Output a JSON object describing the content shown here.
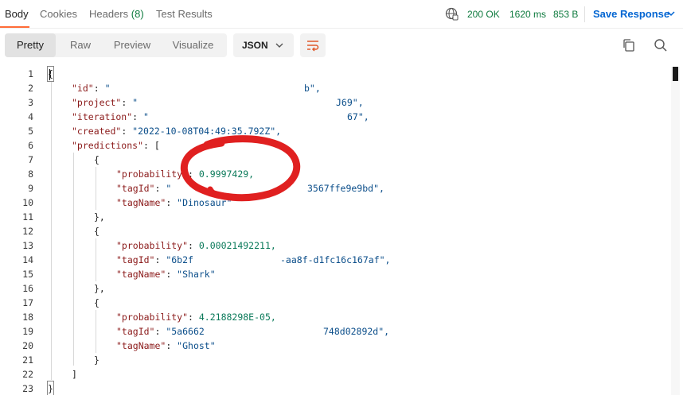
{
  "tabs": {
    "items": [
      {
        "label": "Body",
        "active": true
      },
      {
        "label": "Cookies"
      },
      {
        "label": "Headers",
        "count": "(8)"
      },
      {
        "label": "Test Results"
      }
    ]
  },
  "status": {
    "code": "200 OK",
    "time": "1620 ms",
    "size": "853 B",
    "save_label": "Save Response",
    "ok_color": "#0f7b3f",
    "accent": "#ff6c37"
  },
  "toolbar": {
    "views": [
      "Pretty",
      "Raw",
      "Preview",
      "Visualize"
    ],
    "active_view": "Pretty",
    "format": "JSON",
    "icons": [
      "wrap-lines-icon",
      "copy-icon",
      "search-icon"
    ]
  },
  "editor": {
    "line_numbers": [
      "1",
      "2",
      "3",
      "4",
      "5",
      "6",
      "7",
      "8",
      "9",
      "10",
      "11",
      "12",
      "13",
      "14",
      "15",
      "16",
      "17",
      "18",
      "19",
      "20",
      "21",
      "22",
      "23"
    ],
    "lines": [
      {
        "open": "{"
      },
      {
        "key": "\"id\"",
        "colon": ": ",
        "value": "\"",
        "tail": "b\","
      },
      {
        "key": "\"project\"",
        "colon": ": ",
        "value": "\"",
        "tail": "J69\","
      },
      {
        "key": "\"iteration\"",
        "colon": ": ",
        "value": "\"",
        "tail": "67\","
      },
      {
        "key": "\"created\"",
        "colon": ": ",
        "value": "\"2022-10-08T04:49:35.792Z\","
      },
      {
        "key": "\"predictions\"",
        "colon": ": ",
        "value": "["
      },
      {
        "open": "{"
      },
      {
        "key": "\"probability\"",
        "colon": ": ",
        "num": "0.9997429,"
      },
      {
        "key": "\"tagId\"",
        "colon": ": ",
        "value": "\"",
        "tail": "3567ffe9e9bd\","
      },
      {
        "key": "\"tagName\"",
        "colon": ": ",
        "value": "\"Dinosaur\""
      },
      {
        "open": "},"
      },
      {
        "open": "{"
      },
      {
        "key": "\"probability\"",
        "colon": ": ",
        "num": "0.00021492211,"
      },
      {
        "key": "\"tagId\"",
        "colon": ": ",
        "value": "\"6b2f",
        "tail": "-aa8f-d1fc16c167af\","
      },
      {
        "key": "\"tagName\"",
        "colon": ": ",
        "value": "\"Shark\""
      },
      {
        "open": "},"
      },
      {
        "open": "{"
      },
      {
        "key": "\"probability\"",
        "colon": ": ",
        "num": "4.2188298E-05,"
      },
      {
        "key": "\"tagId\"",
        "colon": ": ",
        "value": "\"5a6662",
        "tail": "748d02892d\","
      },
      {
        "key": "\"tagName\"",
        "colon": ": ",
        "value": "\"Ghost\""
      },
      {
        "open": "}"
      },
      {
        "open": "]"
      },
      {
        "open": "}"
      }
    ]
  }
}
